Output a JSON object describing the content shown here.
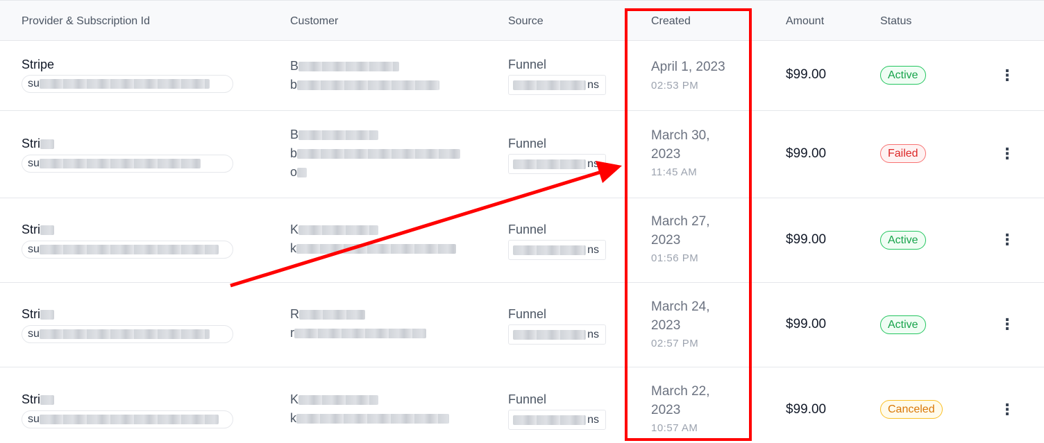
{
  "columns": {
    "provider": "Provider & Subscription Id",
    "customer": "Customer",
    "source": "Source",
    "created": "Created",
    "amount": "Amount",
    "status": "Status"
  },
  "rows": [
    {
      "provider": "Stripe",
      "sub_prefix": "su",
      "cust_line1": "B",
      "cust_line2": "b",
      "cust_line3": "",
      "source": "Funnel",
      "source_suffix": "ns",
      "date": "April 1, 2023",
      "time": "02:53 PM",
      "amount": "$99.00",
      "status": "Active"
    },
    {
      "provider": "Stri",
      "sub_prefix": "su",
      "cust_line1": "B",
      "cust_line2": "b",
      "cust_line3": "o",
      "source": "Funnel",
      "source_suffix": "ns",
      "date": "March 30, 2023",
      "time": "11:45 AM",
      "amount": "$99.00",
      "status": "Failed"
    },
    {
      "provider": "Stri",
      "sub_prefix": "su",
      "cust_line1": "K",
      "cust_line2": "k",
      "cust_line3": "",
      "source": "Funnel",
      "source_suffix": "ns",
      "date": "March 27, 2023",
      "time": "01:56 PM",
      "amount": "$99.00",
      "status": "Active"
    },
    {
      "provider": "Stri",
      "sub_prefix": "su",
      "cust_line1": "R",
      "cust_line2": "r",
      "cust_line3": "",
      "source": "Funnel",
      "source_suffix": "ns",
      "date": "March 24, 2023",
      "time": "02:57 PM",
      "amount": "$99.00",
      "status": "Active"
    },
    {
      "provider": "Stri",
      "sub_prefix": "su",
      "cust_line1": "K",
      "cust_line2": "k",
      "cust_line3": "",
      "source": "Funnel",
      "source_suffix": "ns",
      "date": "March 22, 2023",
      "time": "10:57 AM",
      "amount": "$99.00",
      "status": "Canceled"
    }
  ],
  "icons": {
    "row_menu": "more-vertical-icon"
  },
  "annotation": {
    "color": "#ff0000"
  }
}
